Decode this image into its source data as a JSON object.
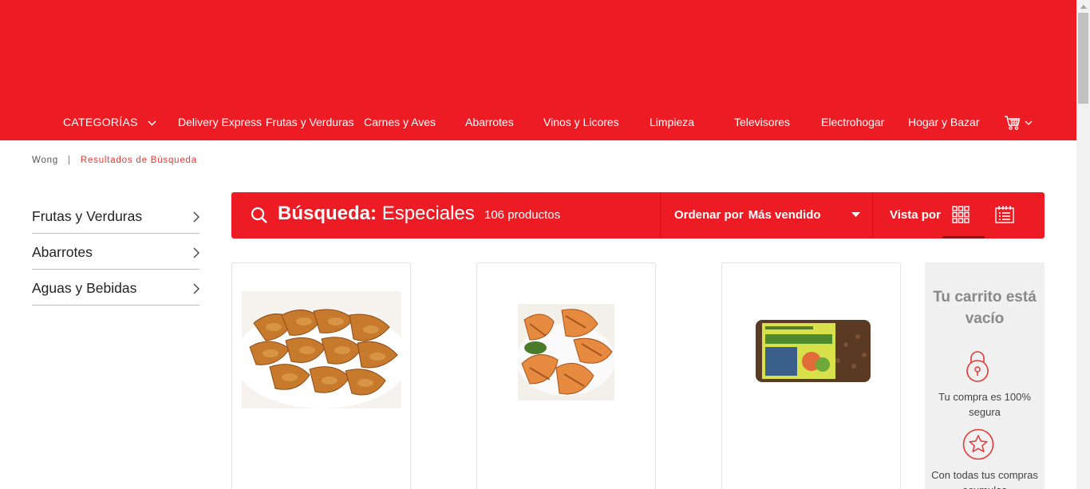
{
  "header": {
    "brand_color": "#ed1c24",
    "categories_label": "CATEGORÍAS",
    "nav_items": [
      "Delivery Express",
      "Frutas y Verduras",
      "Carnes y Aves",
      "Abarrotes",
      "Vinos y Licores",
      "Limpieza",
      "Televisores",
      "Electrohogar",
      "Hogar y Bazar"
    ],
    "cart_icon": "shopping-cart-icon"
  },
  "breadcrumb": {
    "home": "Wong",
    "separator": "|",
    "current": "Resultados de Búsqueda"
  },
  "sidebar": {
    "items": [
      {
        "label": "Frutas y Verduras"
      },
      {
        "label": "Abarrotes"
      },
      {
        "label": "Aguas y Bebidas"
      }
    ]
  },
  "search": {
    "prefix": "Búsqueda:",
    "term": "Especiales",
    "count": "106 productos",
    "sort_label": "Ordenar por",
    "sort_value": "Más vendido",
    "view_label": "Vista por",
    "active_view": "grid"
  },
  "products": [
    {
      "image": "potato-wedges"
    },
    {
      "image": "grilled-chicken"
    },
    {
      "image": "whole-grain-bread"
    }
  ],
  "cart": {
    "title": "Tu carrito está vacío",
    "secure_text": "Tu compra es 100% segura",
    "points_text": "Con todas tus compras acumulas"
  }
}
